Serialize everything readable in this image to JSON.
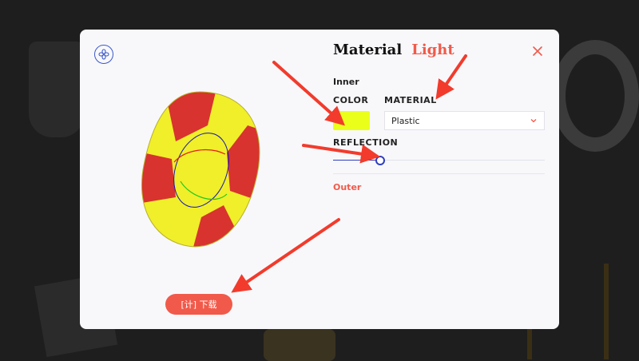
{
  "header": {
    "title": "Material",
    "title_accent": "Light"
  },
  "inner": {
    "label": "Inner",
    "color_label": "COLOR",
    "material_label": "MATERIAL",
    "material_value": "Plastic",
    "reflection_label": "REFLECTION",
    "reflection_fraction": 0.22
  },
  "outer": {
    "label": "Outer"
  },
  "download_label": "[计] 下载",
  "colors": {
    "accent": "#f15a4a",
    "swatch": "#eaff1a",
    "slider": "#2e3fbf",
    "arrow": "#f23b2c"
  }
}
